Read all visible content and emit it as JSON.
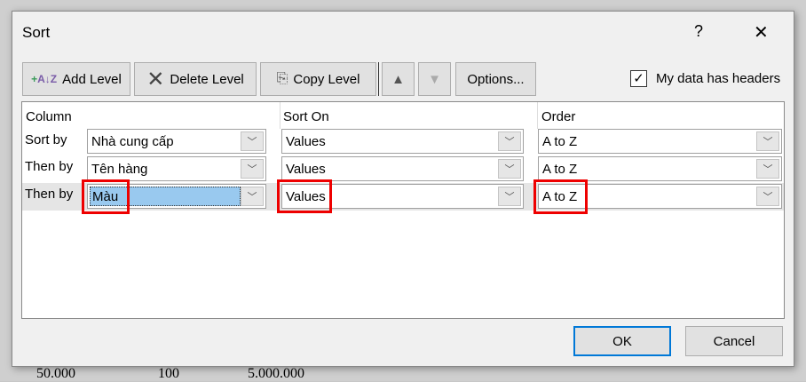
{
  "window": {
    "title": "Sort",
    "help": "?",
    "close": "✕"
  },
  "toolbar": {
    "add_level": "Add Level",
    "delete_level": "Delete Level",
    "copy_level": "Copy Level",
    "options": "Options...",
    "headers_checkbox": "My data has headers",
    "headers_checked": true
  },
  "grid": {
    "headers": [
      "Column",
      "Sort On",
      "Order"
    ],
    "rows": [
      {
        "label": "Sort by",
        "column": "Nhà cung cấp",
        "sort_on": "Values",
        "order": "A to Z"
      },
      {
        "label": "Then by",
        "column": "Tên hàng",
        "sort_on": "Values",
        "order": "A to Z"
      },
      {
        "label": "Then by",
        "column": "Màu",
        "sort_on": "Values",
        "order": "A to Z"
      }
    ]
  },
  "footer": {
    "ok": "OK",
    "cancel": "Cancel"
  },
  "background_cells": [
    "50.000",
    "100",
    "5.000.000"
  ],
  "colors": {
    "highlight": "#e00000",
    "selection": "#99c9ef"
  }
}
